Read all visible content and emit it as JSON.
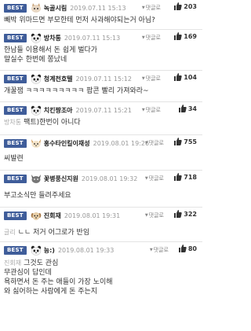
{
  "comments": [
    {
      "best": "BEST",
      "nick": "녹골시림",
      "date": "2019.07.11 15:13",
      "reply": "댓글로",
      "likes": "203",
      "lines": [
        "빼박 위마드면 부모한테 먼저 사과해야되는거 아님?"
      ],
      "avatar": "cat"
    },
    {
      "best": "BEST",
      "nick": "방차통",
      "date": "2019.07.11 15:13",
      "reply": "댓글로",
      "likes": "169",
      "lines": [
        "한남들 이용해서 돈 쉽게 벌다가",
        "말실수 한번에 쫑났네"
      ],
      "avatar": "panda"
    },
    {
      "best": "BEST",
      "nick": "청계천호텔",
      "date": "2019.07.11 15:12",
      "reply": "댓글로",
      "likes": "104",
      "lines": [
        "개꿀잼 ㅋㅋㅋㅋㅋㅋㅋㅋㅋ 팝콘 빨리 가져와라~"
      ],
      "avatar": "panda"
    },
    {
      "best": "BEST",
      "nick": "치킨짱조아",
      "date": "2019.07.11 15:21",
      "reply": "댓글로",
      "likes": "34",
      "quote": "방차통",
      "lines": [
        "팩트)한번이 아니다"
      ],
      "avatar": "panda"
    },
    {
      "best": "BEST",
      "nick": "홍수타인킬이재성",
      "date": "2019.08.01 19:26",
      "reply": "댓글로",
      "likes": "755",
      "lines": [
        "씨발련"
      ],
      "avatar": "fox"
    },
    {
      "best": "BEST",
      "nick": "꽃병풍신지원",
      "date": "2019.08.01 19:32",
      "reply": "댓글로",
      "likes": "718",
      "lines": [
        "부고소식만 들려주세요"
      ],
      "avatar": "cat2"
    },
    {
      "best": "BEST",
      "nick": "진회재",
      "date": "2019.08.01 19:31",
      "reply": "댓글로",
      "likes": "322",
      "quote": "글리",
      "lines": [
        "ㄴㄴ 저거 어그로가 반임"
      ],
      "avatar": "dog"
    },
    {
      "best": "BEST",
      "nick": "능:)",
      "date": "2019.08.01 19:33",
      "reply": "댓글로",
      "likes": "80",
      "quote": "진회재",
      "lines": [
        "그것도 관심",
        "무관심이 답인데",
        "욕하면서 돈 주는 애들이 가장 노이해",
        "와 싫어하는 사람에게 돈 주는지"
      ],
      "avatar": "panda"
    }
  ],
  "colors": {
    "best_badge": "#3f5d9a",
    "date": "#999999"
  },
  "icons": {
    "reply": "triangle-down-icon",
    "like": "thumbs-up-icon"
  }
}
